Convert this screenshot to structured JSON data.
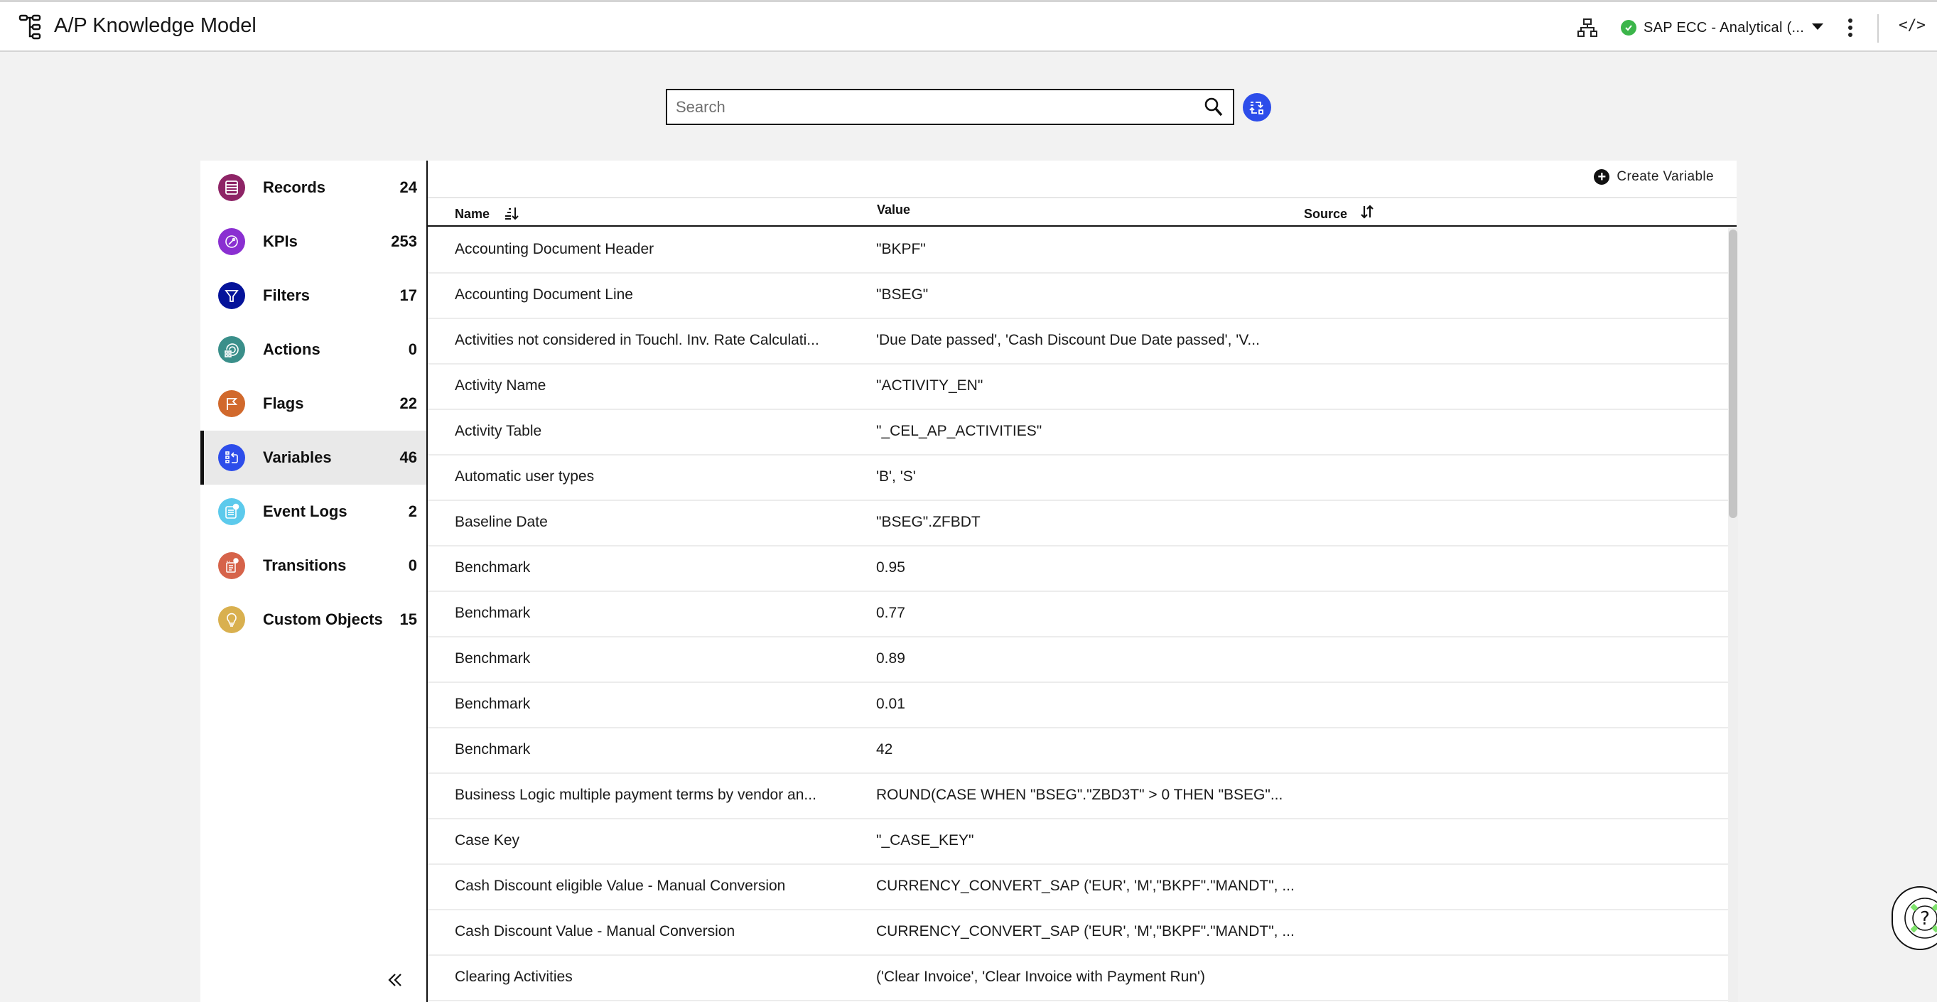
{
  "header": {
    "title": "A/P Knowledge Model",
    "connection_label": "SAP ECC - Analytical (...",
    "connection_status_color": "#3bb54a",
    "icons": [
      "knowledge-model-tree-icon",
      "hierarchy-icon",
      "check-circle-icon",
      "caret-down-icon",
      "kebab-menu-icon",
      "code-icon"
    ],
    "code_glyph": "</>"
  },
  "search": {
    "placeholder": "Search",
    "value": "",
    "switch_button_color": "#2d4dea"
  },
  "sidebar": {
    "items": [
      {
        "label": "Records",
        "count": "24",
        "icon": "records-icon",
        "color": "#8e2466",
        "active": false
      },
      {
        "label": "KPIs",
        "count": "253",
        "icon": "kpi-compass-icon",
        "color": "#8a2fd1",
        "active": false
      },
      {
        "label": "Filters",
        "count": "17",
        "icon": "filter-funnel-icon",
        "color": "#05139a",
        "active": false
      },
      {
        "label": "Actions",
        "count": "0",
        "icon": "actions-icon",
        "color": "#3a8f8a",
        "active": false
      },
      {
        "label": "Flags",
        "count": "22",
        "icon": "flag-icon",
        "color": "#d1692c",
        "active": false
      },
      {
        "label": "Variables",
        "count": "46",
        "icon": "variables-icon",
        "color": "#2d4dea",
        "active": true
      },
      {
        "label": "Event Logs",
        "count": "2",
        "icon": "event-log-icon",
        "color": "#5ccaec",
        "active": false
      },
      {
        "label": "Transitions",
        "count": "0",
        "icon": "transitions-icon",
        "color": "#d6634a",
        "active": false
      },
      {
        "label": "Custom Objects",
        "count": "15",
        "icon": "lightbulb-icon",
        "color": "#d9b04f",
        "active": false
      }
    ],
    "collapse_glyph": "«"
  },
  "panel": {
    "create_label": "Create Variable",
    "create_glyph": "+",
    "columns": [
      {
        "label": "Name",
        "sort": "ascending"
      },
      {
        "label": "Value",
        "sort": "none"
      },
      {
        "label": "Source",
        "sort": "toggle"
      }
    ],
    "rows": [
      {
        "name": "Accounting Document Header",
        "value": "\"BKPF\"",
        "source": ""
      },
      {
        "name": "Accounting Document Line",
        "value": "\"BSEG\"",
        "source": ""
      },
      {
        "name": "Activities not considered in Touchl. Inv. Rate Calculati...",
        "value": "'Due Date passed', 'Cash Discount Due Date passed', 'V...",
        "source": ""
      },
      {
        "name": "Activity Name",
        "value": "\"ACTIVITY_EN\"",
        "source": ""
      },
      {
        "name": "Activity Table",
        "value": "\"_CEL_AP_ACTIVITIES\"",
        "source": ""
      },
      {
        "name": "Automatic user types",
        "value": "'B', 'S'",
        "source": ""
      },
      {
        "name": "Baseline Date",
        "value": "\"BSEG\".ZFBDT",
        "source": ""
      },
      {
        "name": "Benchmark",
        "value": "0.95",
        "source": ""
      },
      {
        "name": "Benchmark",
        "value": "0.77",
        "source": ""
      },
      {
        "name": "Benchmark",
        "value": "0.89",
        "source": ""
      },
      {
        "name": "Benchmark",
        "value": "0.01",
        "source": ""
      },
      {
        "name": "Benchmark",
        "value": "42",
        "source": ""
      },
      {
        "name": "Business Logic multiple payment terms by vendor an...",
        "value": "ROUND(CASE WHEN \"BSEG\".\"ZBD3T\" > 0 THEN \"BSEG\"...",
        "source": ""
      },
      {
        "name": "Case Key",
        "value": "\"_CASE_KEY\"",
        "source": ""
      },
      {
        "name": "Cash Discount eligible Value - Manual Conversion",
        "value": "CURRENCY_CONVERT_SAP ('EUR', 'M',\"BKPF\".\"MANDT\", ...",
        "source": ""
      },
      {
        "name": "Cash Discount Value - Manual Conversion",
        "value": "CURRENCY_CONVERT_SAP ('EUR', 'M',\"BKPF\".\"MANDT\", ...",
        "source": ""
      },
      {
        "name": "Clearing Activities",
        "value": "('Clear Invoice', 'Clear Invoice with Payment Run')",
        "source": ""
      }
    ]
  },
  "help": {
    "glyph": "?",
    "accent_color": "#7ee36b"
  }
}
